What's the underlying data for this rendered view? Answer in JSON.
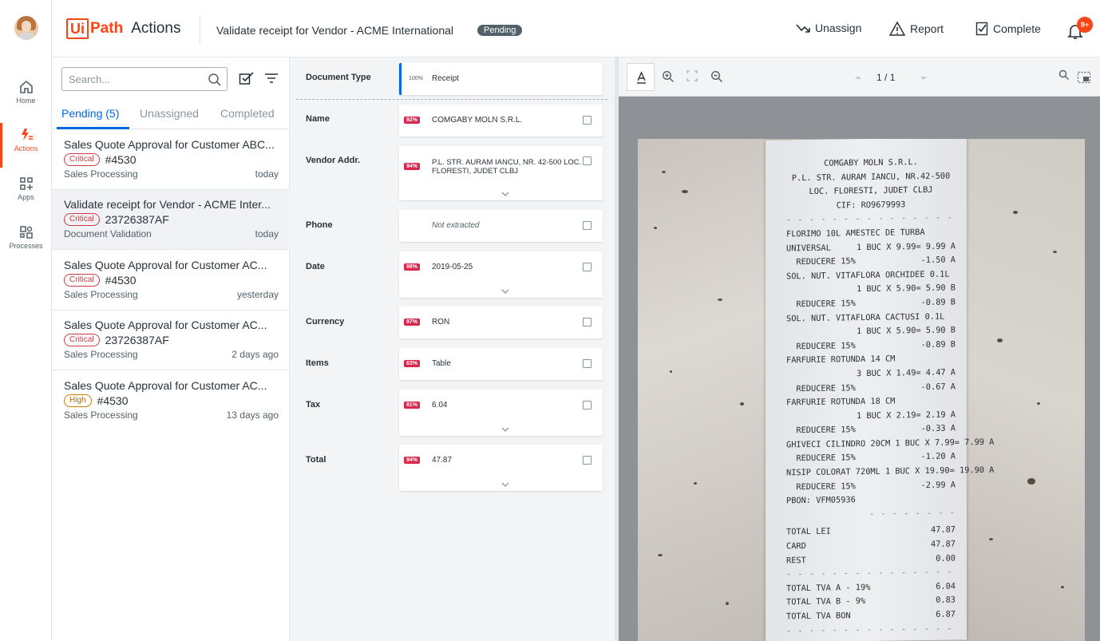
{
  "rail": {
    "items": [
      {
        "label": "Home"
      },
      {
        "label": "Actions"
      },
      {
        "label": "Apps"
      },
      {
        "label": "Processes"
      }
    ]
  },
  "header": {
    "logo_box": "Ui",
    "logo_path": "Path",
    "logo_app": "Actions",
    "title": "Validate receipt for Vendor - ACME International",
    "status": "Pending",
    "unassign": "Unassign",
    "report": "Report",
    "complete": "Complete",
    "notifications": "9+"
  },
  "task_list": {
    "search_placeholder": "Search...",
    "tabs": [
      "Pending (5)",
      "Unassigned",
      "Completed"
    ],
    "tasks": [
      {
        "title": "Sales Quote Approval for Customer ABC...",
        "priority": "Critical",
        "id": "#4530",
        "category": "Sales Processing",
        "time": "today"
      },
      {
        "title": "Validate receipt for Vendor - ACME Inter...",
        "priority": "Critical",
        "id": "23726387AF",
        "category": "Document Validation",
        "time": "today"
      },
      {
        "title": "Sales Quote Approval for Customer AC...",
        "priority": "Critical",
        "id": "#4530",
        "category": "Sales Processing",
        "time": "yesterday"
      },
      {
        "title": "Sales Quote Approval for Customer AC...",
        "priority": "Critical",
        "id": "23726387AF",
        "category": "Sales Processing",
        "time": "2 days ago"
      },
      {
        "title": "Sales Quote Approval for Customer AC...",
        "priority": "High",
        "id": "#4530",
        "category": "Sales Processing",
        "time": "13 days ago"
      }
    ]
  },
  "fields": [
    {
      "label": "Document Type",
      "confidence": "100%",
      "value": "Receipt"
    },
    {
      "label": "Name",
      "confidence": "92%",
      "value": "COMGABY MOLN S.R.L."
    },
    {
      "label": "Vendor Addr.",
      "confidence": "94%",
      "value": "P.L. STR. AURAM IANCU, NR. 42-500 LOC.",
      "value2": "FLORESTI, JUDET CLBJ"
    },
    {
      "label": "Phone",
      "confidence": "",
      "value": "Not extracted"
    },
    {
      "label": "Date",
      "confidence": "98%",
      "value": "2019-05-25"
    },
    {
      "label": "Currency",
      "confidence": "97%",
      "value": "RON"
    },
    {
      "label": "Items",
      "confidence": "63%",
      "value": "Table"
    },
    {
      "label": "Tax",
      "confidence": "81%",
      "value": "6.04"
    },
    {
      "label": "Total",
      "confidence": "94%",
      "value": "47.87"
    }
  ],
  "viewer": {
    "page_current": "1",
    "page_sep": "/",
    "page_total": "1"
  },
  "receipt": {
    "header": [
      "COMGABY MOLN S.R.L.",
      "P.L. STR. AURAM IANCU, NR.42-500",
      "LOC. FLORESTI, JUDET CLBJ",
      "CIF: RO9679993"
    ],
    "lines": [
      {
        "l": "FLORIMO 10L AMESTEC DE TURBA",
        "r": ""
      },
      {
        "l": "UNIVERSAL",
        "r": "1 BUC X 9.99= 9.99 A"
      },
      {
        "l": "  REDUCERE 15%",
        "r": "-1.50 A"
      },
      {
        "l": "SOL. NUT. VITAFLORA ORCHIDEE 0.1L",
        "r": ""
      },
      {
        "l": "",
        "r": "1 BUC X 5.90= 5.90 B"
      },
      {
        "l": "  REDUCERE 15%",
        "r": "-0.89 B"
      },
      {
        "l": "SOL. NUT. VITAFLORA CACTUSI 0.1L",
        "r": ""
      },
      {
        "l": "",
        "r": "1 BUC X 5.90= 5.90 B"
      },
      {
        "l": "  REDUCERE 15%",
        "r": "-0.89 B"
      },
      {
        "l": "FARFURIE ROTUNDA 14 CM",
        "r": ""
      },
      {
        "l": "",
        "r": "3 BUC X 1.49= 4.47 A"
      },
      {
        "l": "  REDUCERE 15%",
        "r": "-0.67 A"
      },
      {
        "l": "FARFURIE ROTUNDA 18 CM",
        "r": ""
      },
      {
        "l": "",
        "r": "1 BUC X 2.19= 2.19 A"
      },
      {
        "l": "  REDUCERE 15%",
        "r": "-0.33 A"
      },
      {
        "l": "GHIVECI CILINDRO 20CM 1 BUC X 7.99= 7.99 A",
        "r": ""
      },
      {
        "l": "  REDUCERE 15%",
        "r": "-1.20 A"
      },
      {
        "l": "NISIP COLORAT 720ML 1 BUC X 19.90= 19.90 A",
        "r": ""
      },
      {
        "l": "  REDUCERE 15%",
        "r": "-2.99 A"
      },
      {
        "l": "PBON: VFM05936",
        "r": ""
      }
    ],
    "totals": [
      {
        "l": "TOTAL LEI",
        "r": "47.87"
      },
      {
        "l": "CARD",
        "r": "47.87"
      },
      {
        "l": "REST",
        "r": "0.00"
      }
    ],
    "tva": [
      {
        "l": "TOTAL TVA A - 19%",
        "r": "6.04"
      },
      {
        "l": "TOTAL TVA B - 9%",
        "r": "0.83"
      },
      {
        "l": "TOTAL TVA BON",
        "r": "6.87"
      }
    ]
  }
}
